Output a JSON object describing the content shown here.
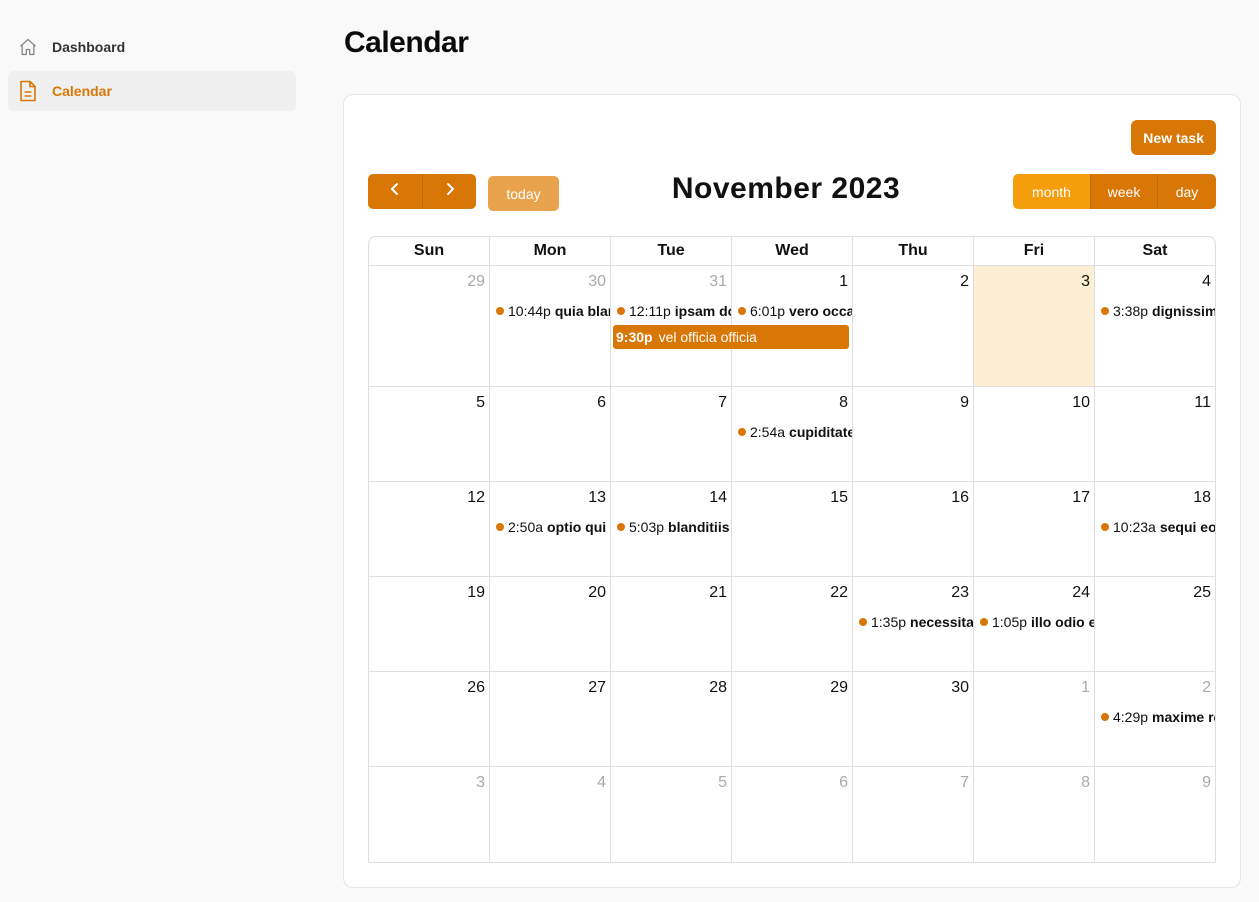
{
  "sidebar": {
    "items": [
      {
        "label": "Dashboard",
        "icon": "home-icon",
        "active": false
      },
      {
        "label": "Calendar",
        "icon": "document-icon",
        "active": true
      }
    ]
  },
  "page": {
    "title": "Calendar"
  },
  "toolbar": {
    "new_task": "New task",
    "today": "today",
    "title": "November 2023",
    "views": [
      "month",
      "week",
      "day"
    ],
    "active_view": "month"
  },
  "weekdays": [
    "Sun",
    "Mon",
    "Tue",
    "Wed",
    "Thu",
    "Fri",
    "Sat"
  ],
  "weeks": [
    [
      {
        "d": "29",
        "other": true
      },
      {
        "d": "30",
        "other": true,
        "ev": {
          "time": "10:44p",
          "title": "quia blanditiis"
        }
      },
      {
        "d": "31",
        "other": true,
        "ev": {
          "time": "12:11p",
          "title": "ipsam dolor"
        }
      },
      {
        "d": "1",
        "ev": {
          "time": "6:01p",
          "title": "vero occaecati"
        }
      },
      {
        "d": "2"
      },
      {
        "d": "3",
        "today": true
      },
      {
        "d": "4",
        "ev": {
          "time": "3:38p",
          "title": "dignissimos"
        }
      }
    ],
    [
      {
        "d": "5"
      },
      {
        "d": "6"
      },
      {
        "d": "7"
      },
      {
        "d": "8",
        "ev": {
          "time": "2:54a",
          "title": "cupiditate"
        }
      },
      {
        "d": "9"
      },
      {
        "d": "10"
      },
      {
        "d": "11"
      }
    ],
    [
      {
        "d": "12"
      },
      {
        "d": "13",
        "ev": {
          "time": "2:50a",
          "title": "optio qui"
        }
      },
      {
        "d": "14",
        "ev": {
          "time": "5:03p",
          "title": "blanditiis"
        }
      },
      {
        "d": "15"
      },
      {
        "d": "16"
      },
      {
        "d": "17"
      },
      {
        "d": "18",
        "ev": {
          "time": "10:23a",
          "title": "sequi eos"
        }
      }
    ],
    [
      {
        "d": "19"
      },
      {
        "d": "20"
      },
      {
        "d": "21"
      },
      {
        "d": "22"
      },
      {
        "d": "23",
        "ev": {
          "time": "1:35p",
          "title": "necessitatibus"
        }
      },
      {
        "d": "24",
        "ev": {
          "time": "1:05p",
          "title": "illo odio et"
        }
      },
      {
        "d": "25"
      }
    ],
    [
      {
        "d": "26"
      },
      {
        "d": "27"
      },
      {
        "d": "28"
      },
      {
        "d": "29"
      },
      {
        "d": "30"
      },
      {
        "d": "1",
        "other": true
      },
      {
        "d": "2",
        "other": true,
        "ev": {
          "time": "4:29p",
          "title": "maxime rem"
        }
      }
    ],
    [
      {
        "d": "3",
        "other": true
      },
      {
        "d": "4",
        "other": true
      },
      {
        "d": "5",
        "other": true
      },
      {
        "d": "6",
        "other": true
      },
      {
        "d": "7",
        "other": true
      },
      {
        "d": "8",
        "other": true
      },
      {
        "d": "9",
        "other": true
      }
    ]
  ],
  "multi_day_event": {
    "time": "9:30p",
    "title": "vel officia officia"
  },
  "colors": {
    "accent": "#d97706",
    "accent_light": "#f59e0b",
    "today_bg": "#fdefd3"
  }
}
